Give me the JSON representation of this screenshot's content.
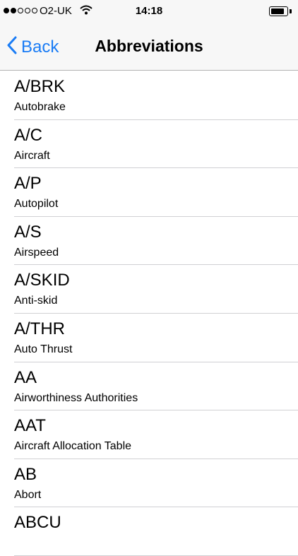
{
  "status_bar": {
    "carrier": "O2-UK",
    "time": "14:18",
    "signal_strength": 2,
    "signal_max": 5,
    "battery_level": 0.85
  },
  "nav": {
    "back_label": "Back",
    "title": "Abbreviations"
  },
  "colors": {
    "accent": "#1a7cf5"
  },
  "items": [
    {
      "abbr": "A/BRK",
      "desc": "Autobrake"
    },
    {
      "abbr": "A/C",
      "desc": "Aircraft"
    },
    {
      "abbr": "A/P",
      "desc": "Autopilot"
    },
    {
      "abbr": "A/S",
      "desc": "Airspeed"
    },
    {
      "abbr": "A/SKID",
      "desc": "Anti-skid"
    },
    {
      "abbr": "A/THR",
      "desc": "Auto Thrust"
    },
    {
      "abbr": "AA",
      "desc": "Airworthiness Authorities"
    },
    {
      "abbr": "AAT",
      "desc": "Aircraft Allocation Table"
    },
    {
      "abbr": "AB",
      "desc": "Abort"
    },
    {
      "abbr": "ABCU",
      "desc": ""
    }
  ]
}
